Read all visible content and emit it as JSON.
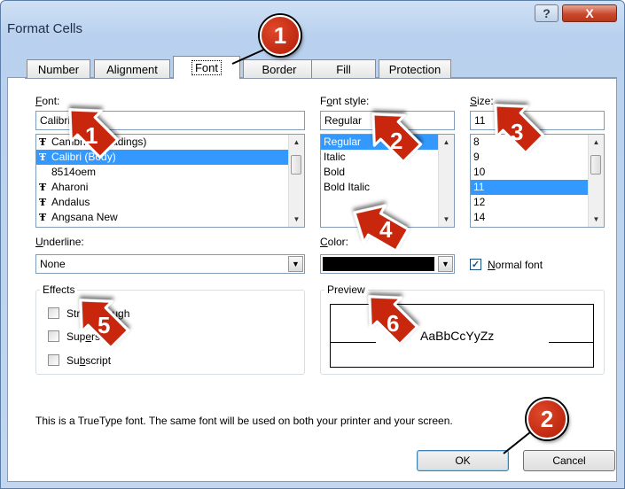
{
  "window": {
    "title": "Format Cells",
    "help_label": "?",
    "close_label": "X"
  },
  "tabs": [
    {
      "label": "Number"
    },
    {
      "label": "Alignment"
    },
    {
      "label": "Font",
      "active": true
    },
    {
      "label": "Border"
    },
    {
      "label": "Fill"
    },
    {
      "label": "Protection"
    }
  ],
  "font": {
    "label_accel": "F",
    "label_rest": "ont:",
    "value": "Calibri",
    "items": [
      {
        "label": "Cambria (Headings)",
        "truetype": true
      },
      {
        "label": "Calibri (Body)",
        "truetype": true,
        "selected": true
      },
      {
        "label": "8514oem",
        "truetype": false
      },
      {
        "label": "Aharoni",
        "truetype": true
      },
      {
        "label": "Andalus",
        "truetype": true
      },
      {
        "label": "Angsana New",
        "truetype": true
      }
    ]
  },
  "font_style": {
    "label_pre": "F",
    "label_accel": "o",
    "label_rest": "nt style:",
    "value": "Regular",
    "items": [
      {
        "label": "Regular",
        "selected": true
      },
      {
        "label": "Italic"
      },
      {
        "label": "Bold"
      },
      {
        "label": "Bold Italic"
      }
    ]
  },
  "size": {
    "label_accel": "S",
    "label_rest": "ize:",
    "value": "11",
    "items": [
      {
        "label": "8"
      },
      {
        "label": "9"
      },
      {
        "label": "10"
      },
      {
        "label": "11",
        "selected": true
      },
      {
        "label": "12"
      },
      {
        "label": "14"
      }
    ]
  },
  "underline": {
    "label_accel": "U",
    "label_rest": "nderline:",
    "value": "None"
  },
  "color": {
    "label_accel": "C",
    "label_rest": "olor:",
    "swatch": "#000000"
  },
  "normal_font": {
    "label_accel": "N",
    "label_rest": "ormal font",
    "checked": true
  },
  "effects": {
    "title": "Effects",
    "items": [
      {
        "pre": "Stri",
        "accel": "k",
        "rest": "ethrough"
      },
      {
        "pre": "Sup",
        "accel": "e",
        "rest": "rscript"
      },
      {
        "pre": "Su",
        "accel": "b",
        "rest": "script"
      }
    ]
  },
  "preview": {
    "title": "Preview",
    "sample": "AaBbCcYyZz"
  },
  "info_text": "This is a TrueType font.  The same font will be used on both your printer and your screen.",
  "buttons": {
    "ok": "OK",
    "cancel": "Cancel"
  },
  "callouts": [
    {
      "number": "1"
    },
    {
      "number": "1"
    },
    {
      "number": "2"
    },
    {
      "number": "3"
    },
    {
      "number": "4"
    },
    {
      "number": "5"
    },
    {
      "number": "6"
    },
    {
      "number": "2"
    }
  ],
  "colors": {
    "selection": "#3399ff",
    "callout_red": "#c8260f",
    "close_red": "#c9492d"
  },
  "icons": {
    "truetype": "truetype-font-icon",
    "scroll_up": "scroll-up-arrow-icon",
    "scroll_down": "scroll-down-arrow-icon",
    "dropdown": "dropdown-arrow-icon",
    "check": "checkmark-icon"
  }
}
